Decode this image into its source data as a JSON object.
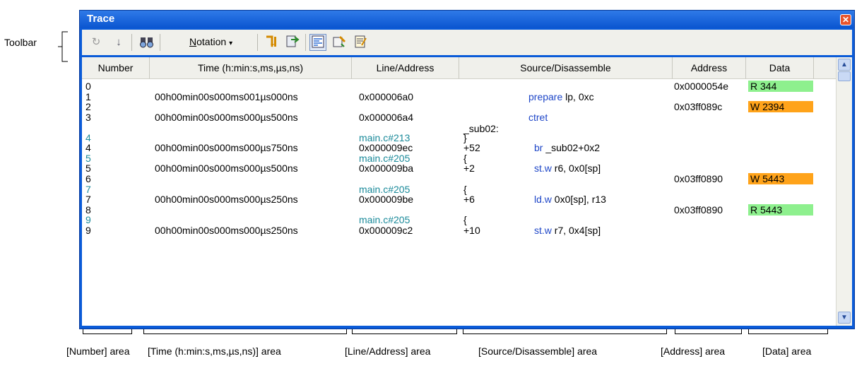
{
  "window": {
    "title": "Trace",
    "close_symbol": "✕"
  },
  "callouts": {
    "toolbar": "Toolbar",
    "number_area": "[Number] area",
    "time_area": "[Time (h:min:s,ms,µs,ns)] area",
    "line_area": "[Line/Address] area",
    "source_area": "[Source/Disassemble] area",
    "address_area": "[Address] area",
    "data_area": "[Data] area"
  },
  "toolbar": {
    "icons": [
      "refresh-icon",
      "step-icon",
      "find-icon",
      "notation-menu",
      "jump-source-icon",
      "jump-disasm-icon",
      "mixed-display-icon",
      "clear-icon",
      "save-icon"
    ],
    "notation_label": "Notation",
    "notation_underline": "N",
    "notation_rest": "otation"
  },
  "columns": [
    "Number",
    "Time (h:min:s,ms,µs,ns)",
    "Line/Address",
    "Source/Disassemble",
    "Address",
    "Data"
  ],
  "rows": [
    {
      "number": "0",
      "time": "",
      "line": "",
      "offset": "",
      "source": "",
      "address": "0x0000054e",
      "data": "R 344",
      "data_type": "R",
      "kind": "normal"
    },
    {
      "number": "1",
      "time": "00h00min00s000ms001µs000ns",
      "line": "0x000006a0",
      "offset": "",
      "source": "prepare  lp, 0xc",
      "address": "",
      "data": "",
      "data_type": "",
      "kind": "normal"
    },
    {
      "number": "2",
      "time": "",
      "line": "",
      "offset": "",
      "source": "",
      "address": "0x03ff089c",
      "data": "W 2394",
      "data_type": "W",
      "kind": "normal"
    },
    {
      "number": "3",
      "time": "00h00min00s000ms000µs500ns",
      "line": "0x000006a4",
      "offset": "",
      "source": "ctret",
      "address": "",
      "data": "",
      "data_type": "",
      "kind": "normal"
    },
    {
      "number": "",
      "time": "",
      "line": "",
      "offset": "_sub02:",
      "source": "",
      "address": "",
      "data": "",
      "data_type": "",
      "kind": "label"
    },
    {
      "number": "4",
      "time": "",
      "line": "main.c#213",
      "offset": "}",
      "source": "",
      "address": "",
      "data": "",
      "data_type": "",
      "kind": "src"
    },
    {
      "number": "4",
      "time": "00h00min00s000ms000µs750ns",
      "line": "0x000009ec",
      "offset": "+52",
      "source": "br   _sub02+0x2",
      "address": "",
      "data": "",
      "data_type": "",
      "kind": "normal"
    },
    {
      "number": "5",
      "time": "",
      "line": "main.c#205",
      "offset": "{",
      "source": "",
      "address": "",
      "data": "",
      "data_type": "",
      "kind": "src"
    },
    {
      "number": "5",
      "time": "00h00min00s000ms000µs500ns",
      "line": "0x000009ba",
      "offset": "+2",
      "source": "st.w   r6, 0x0[sp]",
      "address": "",
      "data": "",
      "data_type": "",
      "kind": "normal"
    },
    {
      "number": "6",
      "time": "",
      "line": "",
      "offset": "",
      "source": "",
      "address": "0x03ff0890",
      "data": "W 5443",
      "data_type": "W",
      "kind": "normal"
    },
    {
      "number": "7",
      "time": "",
      "line": "main.c#205",
      "offset": "{",
      "source": "",
      "address": "",
      "data": "",
      "data_type": "",
      "kind": "src"
    },
    {
      "number": "7",
      "time": "00h00min00s000ms000µs250ns",
      "line": "0x000009be",
      "offset": "+6",
      "source": "ld.w   0x0[sp], r13",
      "address": "",
      "data": "",
      "data_type": "",
      "kind": "normal"
    },
    {
      "number": "8",
      "time": "",
      "line": "",
      "offset": "",
      "source": "",
      "address": "0x03ff0890",
      "data": "R 5443",
      "data_type": "R",
      "kind": "normal"
    },
    {
      "number": "9",
      "time": "",
      "line": "main.c#205",
      "offset": "{",
      "source": "",
      "address": "",
      "data": "",
      "data_type": "",
      "kind": "src"
    },
    {
      "number": "9",
      "time": "00h00min00s000ms000µs250ns",
      "line": "0x000009c2",
      "offset": "+10",
      "source": "st.w   r7, 0x4[sp]",
      "address": "",
      "data": "",
      "data_type": "",
      "kind": "normal"
    }
  ],
  "colors": {
    "title_bar": "#0a55d0",
    "src_line": "#1a8a9a",
    "mnemonic": "#1f47c8",
    "read_bg": "#8ef08e",
    "write_bg": "#ffa31a"
  }
}
